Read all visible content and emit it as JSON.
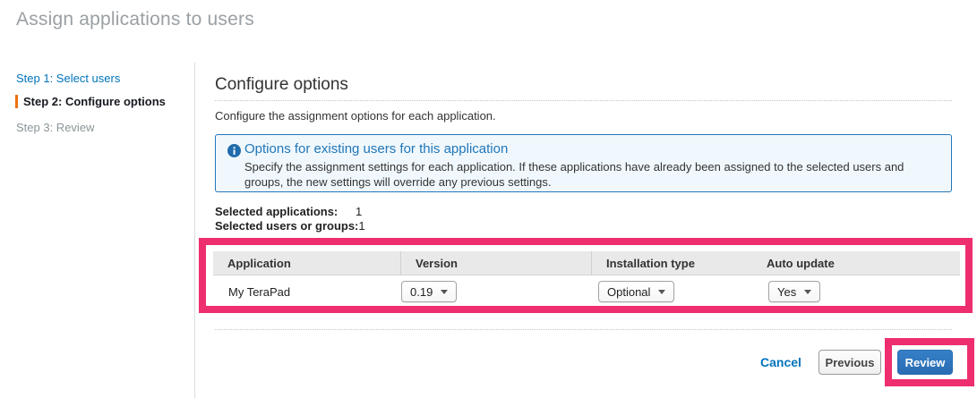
{
  "page": {
    "title": "Assign applications to users"
  },
  "sidebar": {
    "steps": [
      {
        "label": "Step 1: Select users"
      },
      {
        "label": "Step 2: Configure options"
      },
      {
        "label": "Step 3: Review"
      }
    ]
  },
  "main": {
    "heading": "Configure options",
    "description": "Configure the assignment options for each application.",
    "info_box": {
      "icon": "info-icon",
      "title": "Options for existing users for this application",
      "body": "Specify the assignment settings for each application. If these applications have already been assigned to the selected users and groups, the new settings will override any previous settings."
    },
    "summary": [
      {
        "label": "Selected applications:",
        "value": "1"
      },
      {
        "label": "Selected users or groups:",
        "value": "1"
      }
    ],
    "table": {
      "columns": [
        "Application",
        "Version",
        "Installation type",
        "Auto update"
      ],
      "rows": [
        {
          "application": "My TeraPad",
          "version": "0.19",
          "installation_type": "Optional",
          "auto_update": "Yes"
        }
      ]
    },
    "footer": {
      "cancel_label": "Cancel",
      "previous_label": "Previous",
      "review_label": "Review"
    }
  },
  "colors": {
    "annotation_pink": "#ee2e6e",
    "link_blue": "#0073bb",
    "current_step_orange": "#ec7211",
    "info_border_blue": "#2576b9",
    "info_background": "#f0f8fd",
    "primary_button_blue": "#2e76c0",
    "title_gray": "#9aa0a4",
    "table_header_gray": "#e9e9e9"
  }
}
